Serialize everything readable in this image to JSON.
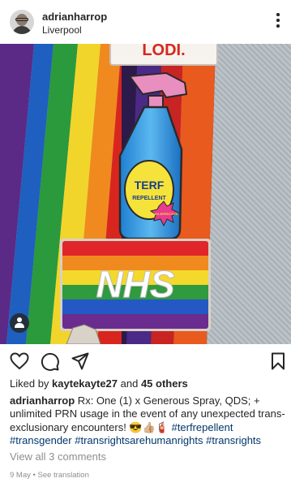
{
  "post": {
    "username": "adrianharrop",
    "location": "Liverpool",
    "pin_text": {
      "banner_partial": "LODI.",
      "bottle_line1": "TERF",
      "bottle_line2": "REPELLENT",
      "bottle_burst": "100% EFFECTIVE",
      "flag_text": "NHS"
    },
    "likes_prefix": "Liked by ",
    "liked_by": "kaytekayte27",
    "likes_and": " and ",
    "likes_others": "45 others",
    "caption_username": "adrianharrop",
    "caption_text": " Rx: One (1) x Generous Spray, QDS; + unlimited PRN usage in the event of any unexpected trans-exclusionary encounters! 😎👍🏼🧯 ",
    "hashtags": [
      "#terfrepellent",
      "#transgender",
      "#transrightsarehumanrights",
      "#transrights"
    ],
    "view_comments": "View all 3 comments",
    "date": "9 May",
    "separator": " • ",
    "see_translation": "See translation"
  },
  "icons": {
    "like": "heart-icon",
    "comment": "comment-icon",
    "share": "share-icon",
    "save": "bookmark-icon",
    "more": "more-vertical-icon",
    "tag": "user-tag-icon"
  },
  "colors": {
    "text": "#262626",
    "hashtag": "#00376b",
    "muted": "#8e8e8e"
  }
}
